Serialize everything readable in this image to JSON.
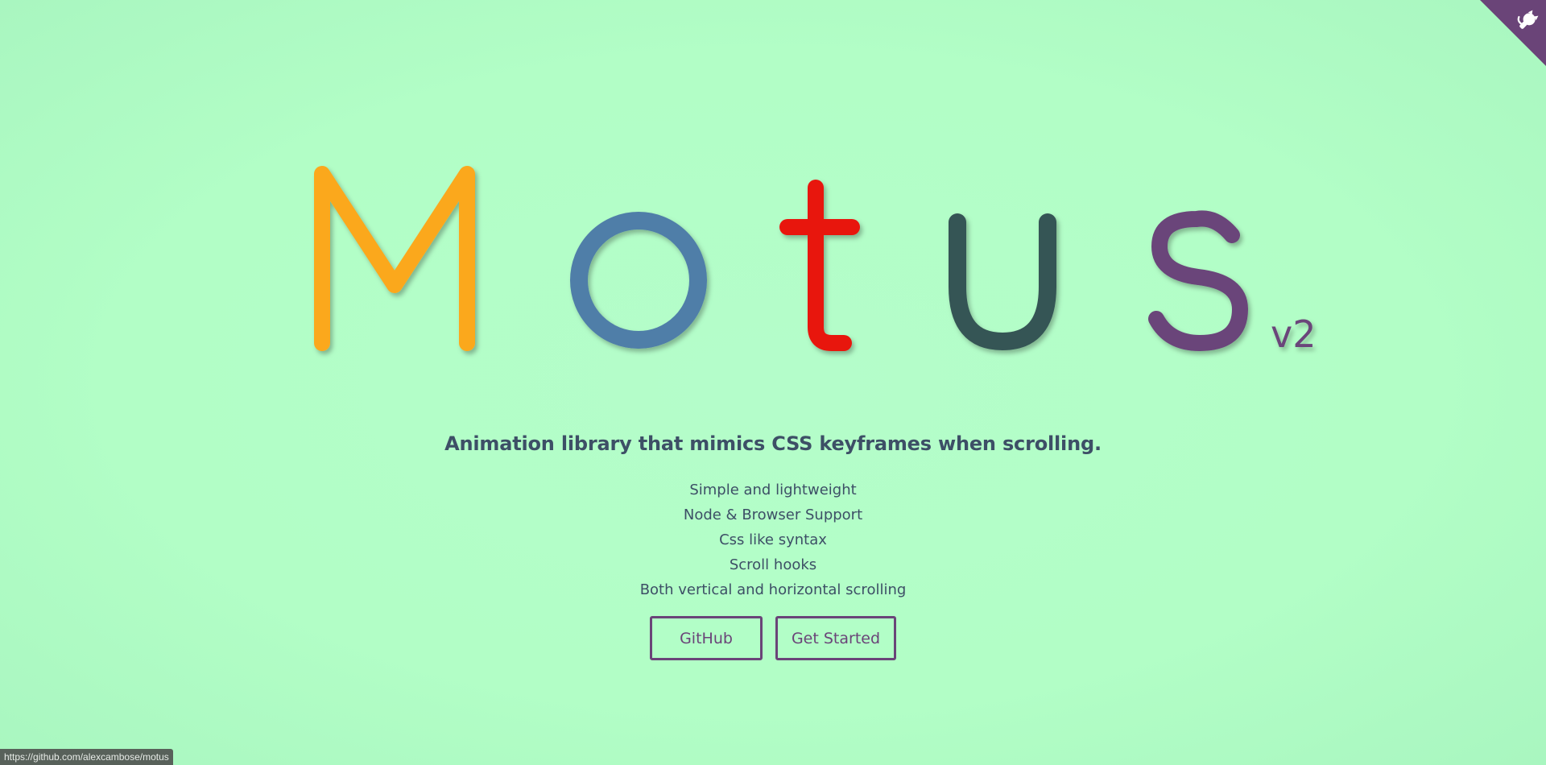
{
  "logo": {
    "letters": [
      {
        "char": "M",
        "color": "#fba81d"
      },
      {
        "char": "o",
        "color": "#4f7ea8"
      },
      {
        "char": "t",
        "color": "#e8170f"
      },
      {
        "char": "u",
        "color": "#365554"
      },
      {
        "char": "s",
        "color": "#6b457a"
      }
    ],
    "version": "v2",
    "version_color": "#6b457a"
  },
  "corner_icon": "github-octocat-icon",
  "corner_color": "#6a4478",
  "tagline": "Animation library that mimics CSS keyframes when scrolling.",
  "features": [
    "Simple and lightweight",
    "Node & Browser Support",
    "Css like syntax",
    "Scroll hooks",
    "Both vertical and horizontal scrolling"
  ],
  "buttons": {
    "github": "GitHub",
    "get_started": "Get Started"
  },
  "status_url": "https://github.com/alexcambose/motus"
}
